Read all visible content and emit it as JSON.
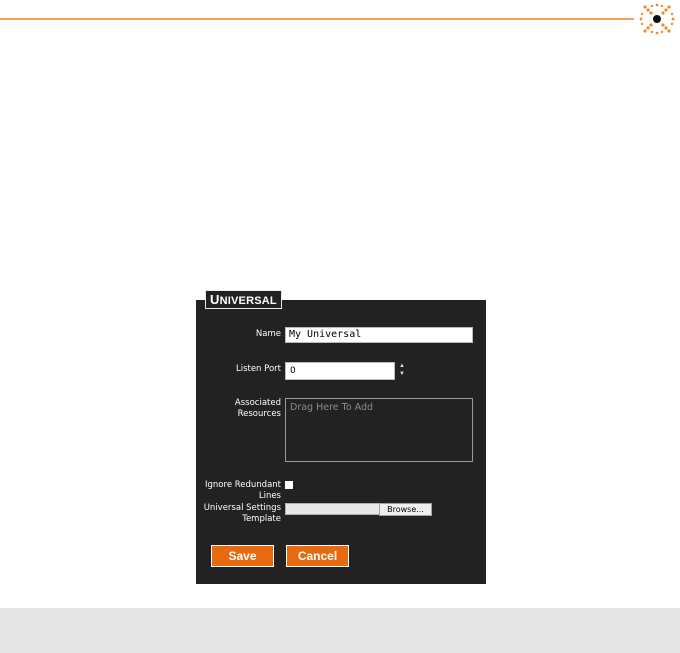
{
  "colors": {
    "accent": "#e86a10",
    "rule": "#f0a35a",
    "panel_bg": "#222222",
    "footer_bg": "#e6e6e6"
  },
  "logo": {
    "icon": "sunburst-logo-icon"
  },
  "panel": {
    "title_first": "U",
    "title_rest": "NIVERSAL"
  },
  "form": {
    "name_label": "Name",
    "name_value": "My Universal",
    "port_label": "Listen Port",
    "port_value": "0",
    "resources_label_1": "Associated",
    "resources_label_2": "Resources",
    "resources_placeholder": "Drag Here To Add",
    "ignore_label_1": "Ignore Redundant",
    "ignore_label_2": "Lines",
    "ignore_checked": false,
    "template_label_1": "Universal Settings",
    "template_label_2": "Template",
    "browse_label": "Browse..."
  },
  "actions": {
    "save_label": "Save",
    "cancel_label": "Cancel"
  }
}
